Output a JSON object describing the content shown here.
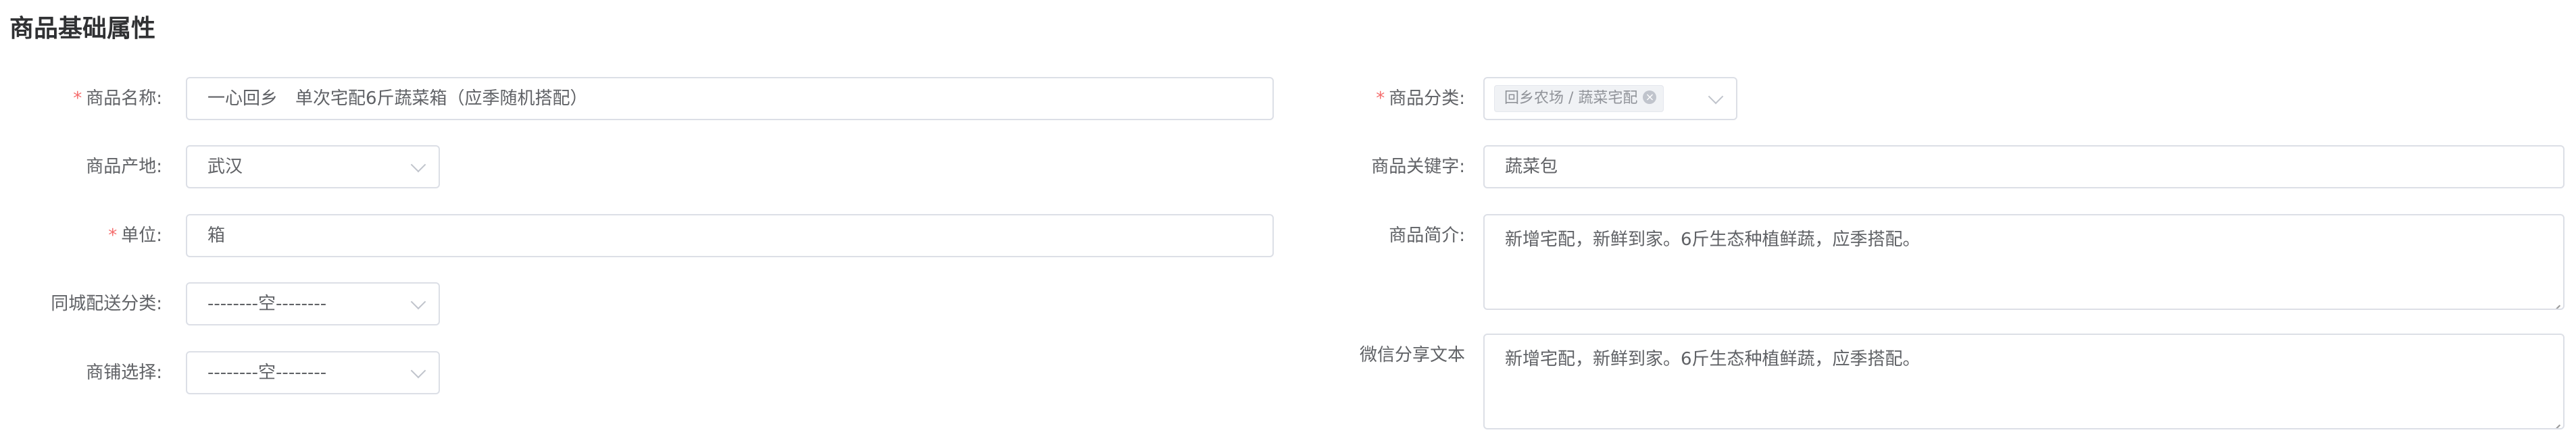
{
  "section": {
    "title": "商品基础属性"
  },
  "fields": {
    "name": {
      "label": "商品名称:",
      "required_mark": "*",
      "value": "一心回乡　单次宅配6斤蔬菜箱（应季随机搭配）"
    },
    "origin": {
      "label": "商品产地:",
      "value": "武汉"
    },
    "unit": {
      "label": "单位:",
      "required_mark": "*",
      "value": "箱"
    },
    "city_delivery": {
      "label": "同城配送分类:",
      "value": "--------空--------"
    },
    "shop": {
      "label": "商铺选择:",
      "value": "--------空--------"
    },
    "category": {
      "label": "商品分类:",
      "required_mark": "*",
      "tag": "回乡农场 / 蔬菜宅配"
    },
    "keywords": {
      "label": "商品关键字:",
      "value": "蔬菜包"
    },
    "intro": {
      "label": "商品简介:",
      "value": "新增宅配，新鲜到家。6斤生态种植鲜蔬，应季搭配。"
    },
    "wechat_share": {
      "label": "微信分享文本",
      "value": "新增宅配，新鲜到家。6斤生态种植鲜蔬，应季搭配。"
    }
  },
  "icons": {
    "select_arrow": "chevron-down-icon",
    "tag_close": "close-circle-icon",
    "textarea_resize": "resize-handle-icon"
  },
  "colors": {
    "required": "#f56c6c",
    "border": "#dcdfe6",
    "label_text": "#606266",
    "title_text": "#303133",
    "tag_bg": "#f0f2f5"
  }
}
